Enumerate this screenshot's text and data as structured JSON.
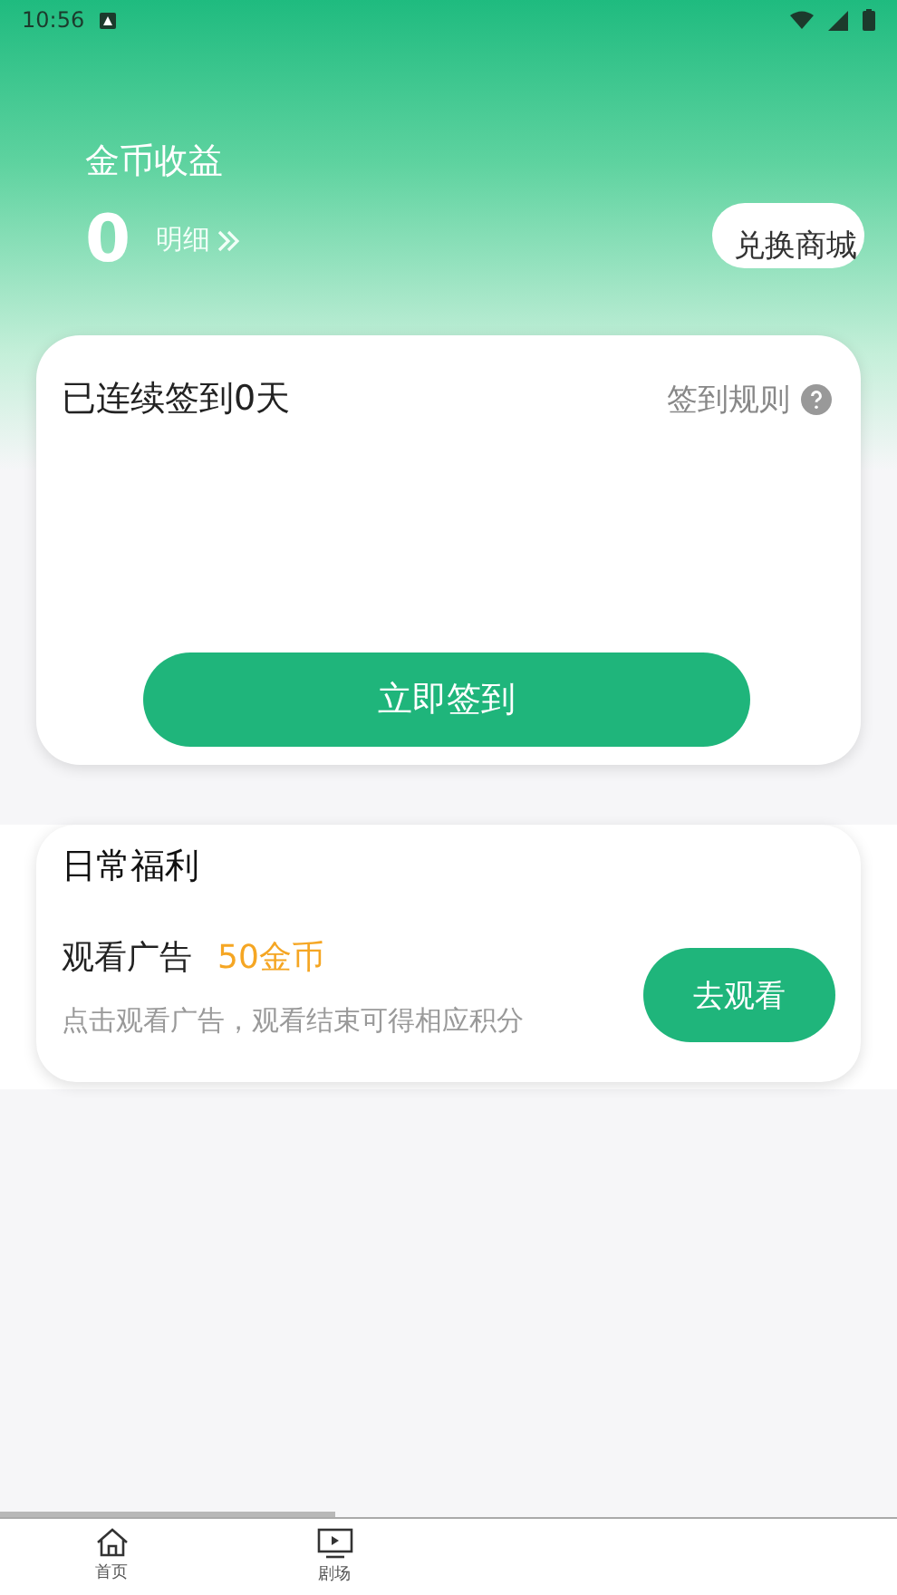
{
  "status_bar": {
    "time": "10:56"
  },
  "coins": {
    "title": "金币收益",
    "amount": "0",
    "detail_link": "明细"
  },
  "shop_button": "兑换商城",
  "sign_in": {
    "streak": "已连续签到0天",
    "rules_link": "签到规则",
    "button": "立即签到"
  },
  "daily": {
    "title": "日常福利",
    "tasks": [
      {
        "name": "观看广告",
        "reward": "50金币",
        "description": "点击观看广告，观看结束可得相应积分",
        "button": "去观看"
      }
    ]
  },
  "bottom_nav": [
    {
      "label": "首页",
      "kind": "home"
    },
    {
      "label": "剧场",
      "kind": "tv"
    }
  ]
}
